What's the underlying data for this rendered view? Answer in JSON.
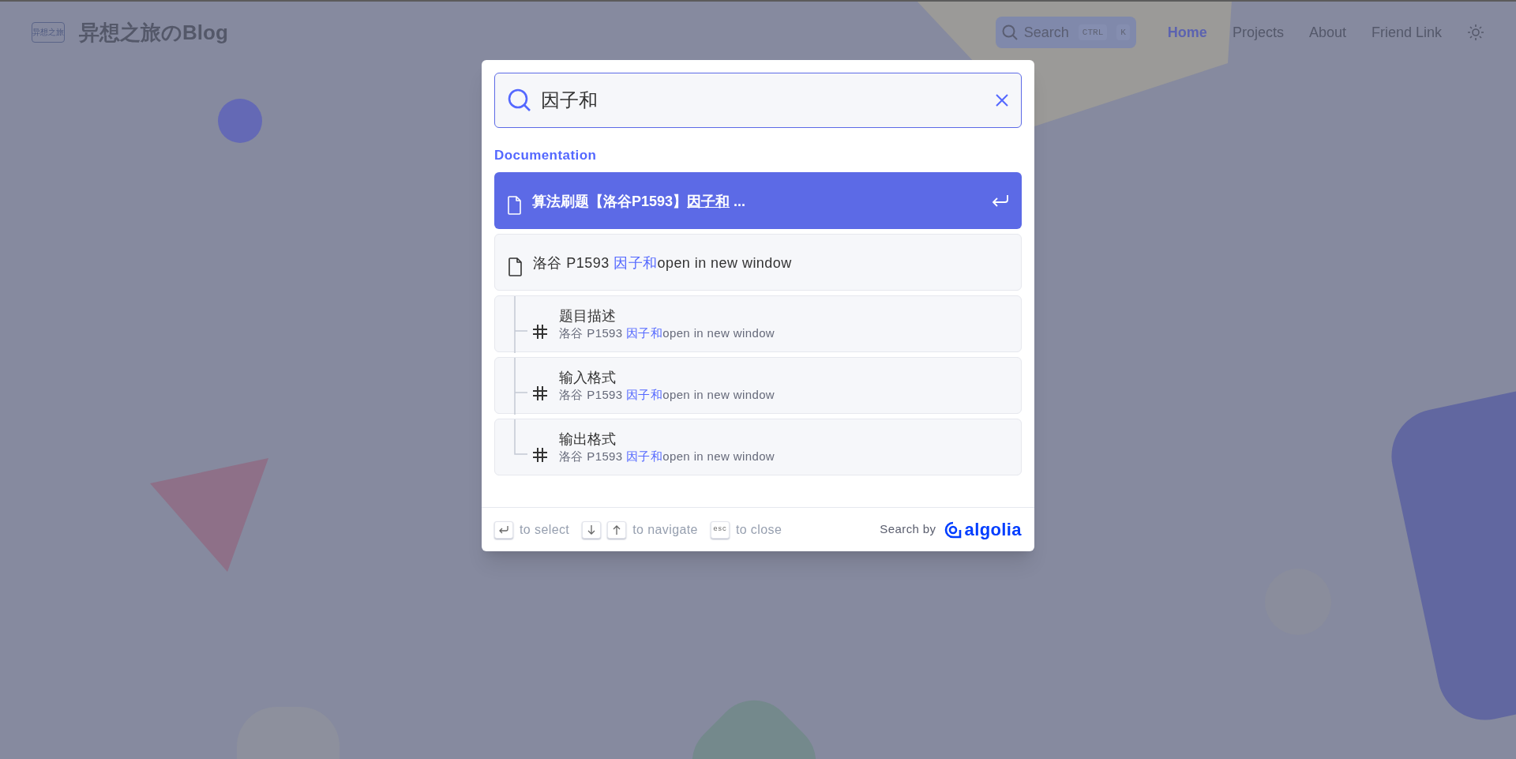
{
  "header": {
    "logo_text": "异想之旅",
    "site_title": "异想之旅のBlog",
    "search": {
      "label": "Search",
      "keys": [
        "CTRL",
        "K"
      ]
    },
    "nav": [
      {
        "label": "Home",
        "selected": true
      },
      {
        "label": "Projects",
        "selected": false
      },
      {
        "label": "About",
        "selected": false
      },
      {
        "label": "Friend Link",
        "selected": false
      }
    ]
  },
  "search_modal": {
    "query": "因子和",
    "source": "Documentation",
    "hits": [
      {
        "kind": "page",
        "selected": true,
        "title": [
          {
            "text": "算法刷题【洛谷P1593】",
            "highlight": false
          },
          {
            "text": "因子和",
            "highlight": true
          },
          {
            "text": " ...",
            "highlight": false
          }
        ]
      },
      {
        "kind": "page",
        "selected": false,
        "title": [
          {
            "text": "洛谷 P1593 ",
            "highlight": false
          },
          {
            "text": "因子和",
            "highlight": true
          },
          {
            "text": "open in new window",
            "highlight": false
          }
        ]
      },
      {
        "kind": "heading",
        "selected": false,
        "title": [
          {
            "text": "题目描述",
            "highlight": false
          }
        ],
        "path": [
          {
            "text": "洛谷 P1593 ",
            "highlight": false
          },
          {
            "text": "因子和",
            "highlight": true
          },
          {
            "text": "open in new window",
            "highlight": false
          }
        ]
      },
      {
        "kind": "heading",
        "selected": false,
        "title": [
          {
            "text": "输入格式",
            "highlight": false
          }
        ],
        "path": [
          {
            "text": "洛谷 P1593 ",
            "highlight": false
          },
          {
            "text": "因子和",
            "highlight": true
          },
          {
            "text": "open in new window",
            "highlight": false
          }
        ]
      },
      {
        "kind": "heading",
        "selected": false,
        "title": [
          {
            "text": "输出格式",
            "highlight": false
          }
        ],
        "path": [
          {
            "text": "洛谷 P1593 ",
            "highlight": false
          },
          {
            "text": "因子和",
            "highlight": true
          },
          {
            "text": "open in new window",
            "highlight": false
          }
        ]
      }
    ],
    "footer": {
      "commands": [
        {
          "kind": "enter",
          "label": "to select"
        },
        {
          "kind": "arrows",
          "label": "to navigate"
        },
        {
          "kind": "esc",
          "key": "esc",
          "label": "to close"
        }
      ],
      "search_by": "Search by",
      "brand": "algolia"
    }
  }
}
